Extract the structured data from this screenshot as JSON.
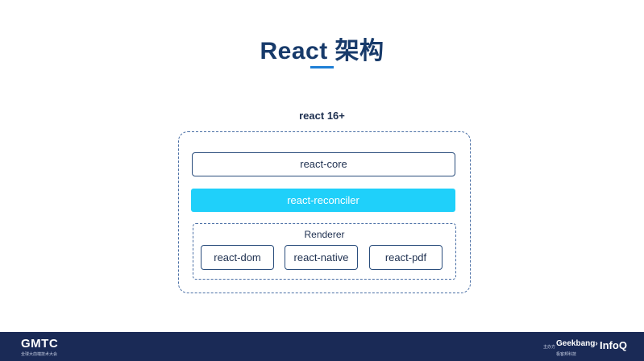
{
  "slide": {
    "title": "React 架构",
    "group_label": "react 16+"
  },
  "diagram": {
    "core": "react-core",
    "reconciler": "react-reconciler",
    "renderer": {
      "label": "Renderer",
      "items": [
        "react-dom",
        "react-native",
        "react-pdf"
      ]
    }
  },
  "footer": {
    "left_logo": "GMTC",
    "left_sub": "全球大前端技术大会",
    "right_small": "主办方",
    "right_geek": "Geekbang›",
    "right_geek_sub": "极客邦科技",
    "right_infoq": "InfoQ"
  },
  "colors": {
    "title": "#173a6a",
    "accent": "#1e7fd6",
    "reconciler_fill": "#1fd0fa",
    "border": "#2a4d7c",
    "footer_bg": "#1a2a56"
  }
}
